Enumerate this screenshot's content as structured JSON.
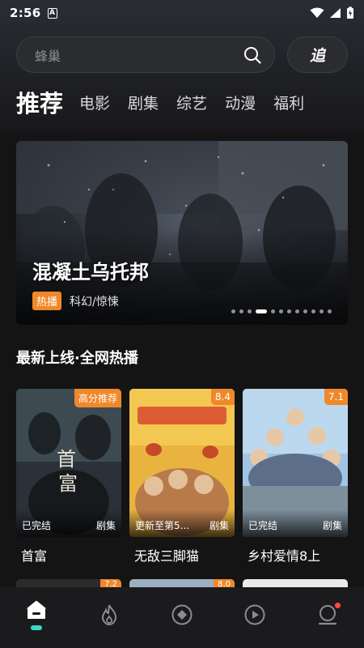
{
  "status": {
    "time": "2:56",
    "a_icon": "A"
  },
  "search": {
    "placeholder": "蜂巢",
    "follow_label": "追"
  },
  "tabs": [
    {
      "label": "推荐",
      "active": true
    },
    {
      "label": "电影"
    },
    {
      "label": "剧集"
    },
    {
      "label": "综艺"
    },
    {
      "label": "动漫"
    },
    {
      "label": "福利"
    }
  ],
  "banner": {
    "title": "混凝土乌托邦",
    "badge": "热播",
    "genre": "科幻/惊悚",
    "dot_count": 12,
    "active_dot": 3
  },
  "section": {
    "title": "最新上线·全网热播"
  },
  "cards": [
    {
      "title": "首富",
      "tag": "高分推荐",
      "status": "已完结",
      "type": "剧集"
    },
    {
      "title": "无敌三脚猫",
      "tag": "8.4",
      "status": "更新至第5...",
      "type": "剧集"
    },
    {
      "title": "乡村爱情8上",
      "tag": "7.1",
      "status": "已完结",
      "type": "剧集"
    }
  ],
  "next_row_tags": [
    "7.2",
    "8.0",
    ""
  ],
  "nav": [
    {
      "name": "home-icon",
      "active": true
    },
    {
      "name": "flame-icon"
    },
    {
      "name": "compass-icon"
    },
    {
      "name": "play-icon"
    },
    {
      "name": "profile-icon",
      "badge": true
    }
  ],
  "colors": {
    "accent": "#f0882a",
    "nav_indicator": "#3ed6c6",
    "badge_red": "#ff4a4a"
  }
}
